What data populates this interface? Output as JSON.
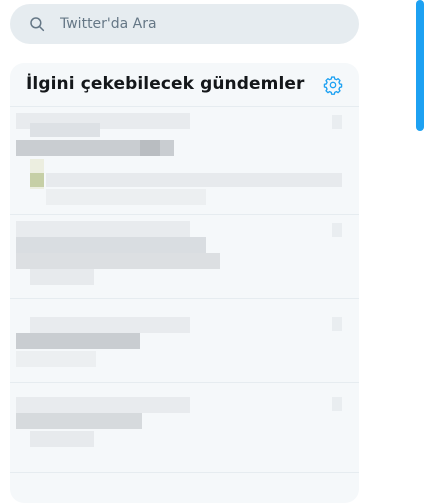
{
  "search": {
    "placeholder": "Twitter'da Ara"
  },
  "trends_panel": {
    "title": "İlgini çekebilecek gündemler",
    "settings_icon": "gear-icon",
    "items_note_blurred": true
  },
  "colors": {
    "accent": "#1da1f2",
    "panel_bg": "#f5f8fa",
    "search_bg": "#e6ecf0",
    "title_text": "#14171a",
    "placeholder_text": "#657786"
  }
}
